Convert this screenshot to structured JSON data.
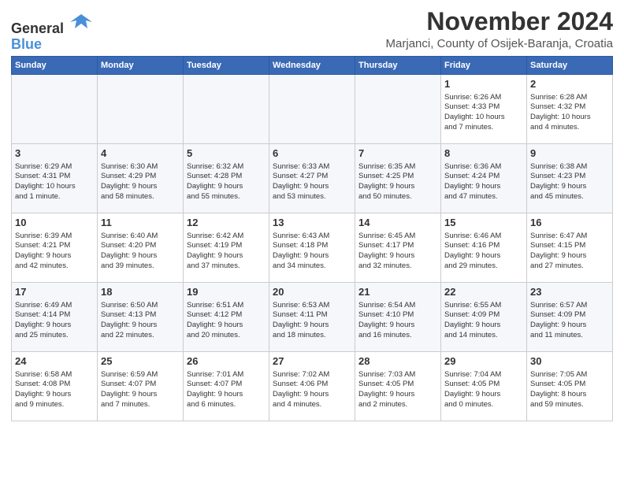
{
  "header": {
    "logo_general": "General",
    "logo_blue": "Blue",
    "month_title": "November 2024",
    "subtitle": "Marjanci, County of Osijek-Baranja, Croatia"
  },
  "calendar": {
    "weekdays": [
      "Sunday",
      "Monday",
      "Tuesday",
      "Wednesday",
      "Thursday",
      "Friday",
      "Saturday"
    ],
    "weeks": [
      [
        {
          "day": "",
          "info": ""
        },
        {
          "day": "",
          "info": ""
        },
        {
          "day": "",
          "info": ""
        },
        {
          "day": "",
          "info": ""
        },
        {
          "day": "",
          "info": ""
        },
        {
          "day": "1",
          "info": "Sunrise: 6:26 AM\nSunset: 4:33 PM\nDaylight: 10 hours\nand 7 minutes."
        },
        {
          "day": "2",
          "info": "Sunrise: 6:28 AM\nSunset: 4:32 PM\nDaylight: 10 hours\nand 4 minutes."
        }
      ],
      [
        {
          "day": "3",
          "info": "Sunrise: 6:29 AM\nSunset: 4:31 PM\nDaylight: 10 hours\nand 1 minute."
        },
        {
          "day": "4",
          "info": "Sunrise: 6:30 AM\nSunset: 4:29 PM\nDaylight: 9 hours\nand 58 minutes."
        },
        {
          "day": "5",
          "info": "Sunrise: 6:32 AM\nSunset: 4:28 PM\nDaylight: 9 hours\nand 55 minutes."
        },
        {
          "day": "6",
          "info": "Sunrise: 6:33 AM\nSunset: 4:27 PM\nDaylight: 9 hours\nand 53 minutes."
        },
        {
          "day": "7",
          "info": "Sunrise: 6:35 AM\nSunset: 4:25 PM\nDaylight: 9 hours\nand 50 minutes."
        },
        {
          "day": "8",
          "info": "Sunrise: 6:36 AM\nSunset: 4:24 PM\nDaylight: 9 hours\nand 47 minutes."
        },
        {
          "day": "9",
          "info": "Sunrise: 6:38 AM\nSunset: 4:23 PM\nDaylight: 9 hours\nand 45 minutes."
        }
      ],
      [
        {
          "day": "10",
          "info": "Sunrise: 6:39 AM\nSunset: 4:21 PM\nDaylight: 9 hours\nand 42 minutes."
        },
        {
          "day": "11",
          "info": "Sunrise: 6:40 AM\nSunset: 4:20 PM\nDaylight: 9 hours\nand 39 minutes."
        },
        {
          "day": "12",
          "info": "Sunrise: 6:42 AM\nSunset: 4:19 PM\nDaylight: 9 hours\nand 37 minutes."
        },
        {
          "day": "13",
          "info": "Sunrise: 6:43 AM\nSunset: 4:18 PM\nDaylight: 9 hours\nand 34 minutes."
        },
        {
          "day": "14",
          "info": "Sunrise: 6:45 AM\nSunset: 4:17 PM\nDaylight: 9 hours\nand 32 minutes."
        },
        {
          "day": "15",
          "info": "Sunrise: 6:46 AM\nSunset: 4:16 PM\nDaylight: 9 hours\nand 29 minutes."
        },
        {
          "day": "16",
          "info": "Sunrise: 6:47 AM\nSunset: 4:15 PM\nDaylight: 9 hours\nand 27 minutes."
        }
      ],
      [
        {
          "day": "17",
          "info": "Sunrise: 6:49 AM\nSunset: 4:14 PM\nDaylight: 9 hours\nand 25 minutes."
        },
        {
          "day": "18",
          "info": "Sunrise: 6:50 AM\nSunset: 4:13 PM\nDaylight: 9 hours\nand 22 minutes."
        },
        {
          "day": "19",
          "info": "Sunrise: 6:51 AM\nSunset: 4:12 PM\nDaylight: 9 hours\nand 20 minutes."
        },
        {
          "day": "20",
          "info": "Sunrise: 6:53 AM\nSunset: 4:11 PM\nDaylight: 9 hours\nand 18 minutes."
        },
        {
          "day": "21",
          "info": "Sunrise: 6:54 AM\nSunset: 4:10 PM\nDaylight: 9 hours\nand 16 minutes."
        },
        {
          "day": "22",
          "info": "Sunrise: 6:55 AM\nSunset: 4:09 PM\nDaylight: 9 hours\nand 14 minutes."
        },
        {
          "day": "23",
          "info": "Sunrise: 6:57 AM\nSunset: 4:09 PM\nDaylight: 9 hours\nand 11 minutes."
        }
      ],
      [
        {
          "day": "24",
          "info": "Sunrise: 6:58 AM\nSunset: 4:08 PM\nDaylight: 9 hours\nand 9 minutes."
        },
        {
          "day": "25",
          "info": "Sunrise: 6:59 AM\nSunset: 4:07 PM\nDaylight: 9 hours\nand 7 minutes."
        },
        {
          "day": "26",
          "info": "Sunrise: 7:01 AM\nSunset: 4:07 PM\nDaylight: 9 hours\nand 6 minutes."
        },
        {
          "day": "27",
          "info": "Sunrise: 7:02 AM\nSunset: 4:06 PM\nDaylight: 9 hours\nand 4 minutes."
        },
        {
          "day": "28",
          "info": "Sunrise: 7:03 AM\nSunset: 4:05 PM\nDaylight: 9 hours\nand 2 minutes."
        },
        {
          "day": "29",
          "info": "Sunrise: 7:04 AM\nSunset: 4:05 PM\nDaylight: 9 hours\nand 0 minutes."
        },
        {
          "day": "30",
          "info": "Sunrise: 7:05 AM\nSunset: 4:05 PM\nDaylight: 8 hours\nand 59 minutes."
        }
      ]
    ]
  }
}
